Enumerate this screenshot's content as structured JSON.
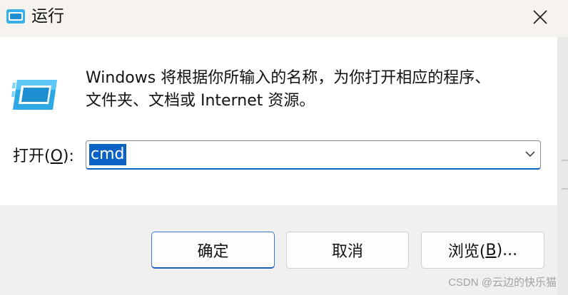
{
  "window": {
    "title": "运行",
    "title_icon": "run-dialog-icon",
    "close_icon": "close-icon"
  },
  "description": {
    "icon": "run-dialog-icon",
    "line1": "Windows 将根据你所输入的名称，为你打开相应的程序、",
    "line2": "文件夹、文档或 Internet 资源。"
  },
  "open": {
    "label_prefix": "打开(",
    "label_key": "O",
    "label_suffix": "):",
    "value": "cmd",
    "dropdown_icon": "chevron-down-icon"
  },
  "buttons": {
    "ok": "确定",
    "cancel": "取消",
    "browse_prefix": "浏览(",
    "browse_key": "B",
    "browse_suffix": ")..."
  },
  "watermark": "CSDN @云边的快乐猫",
  "colors": {
    "accent": "#0a62c4",
    "title_bar": "#f6f2ee",
    "content_bg": "#ffffff",
    "footer_bg": "#f0f0f0",
    "icon_blue": "#2aa3e0"
  }
}
